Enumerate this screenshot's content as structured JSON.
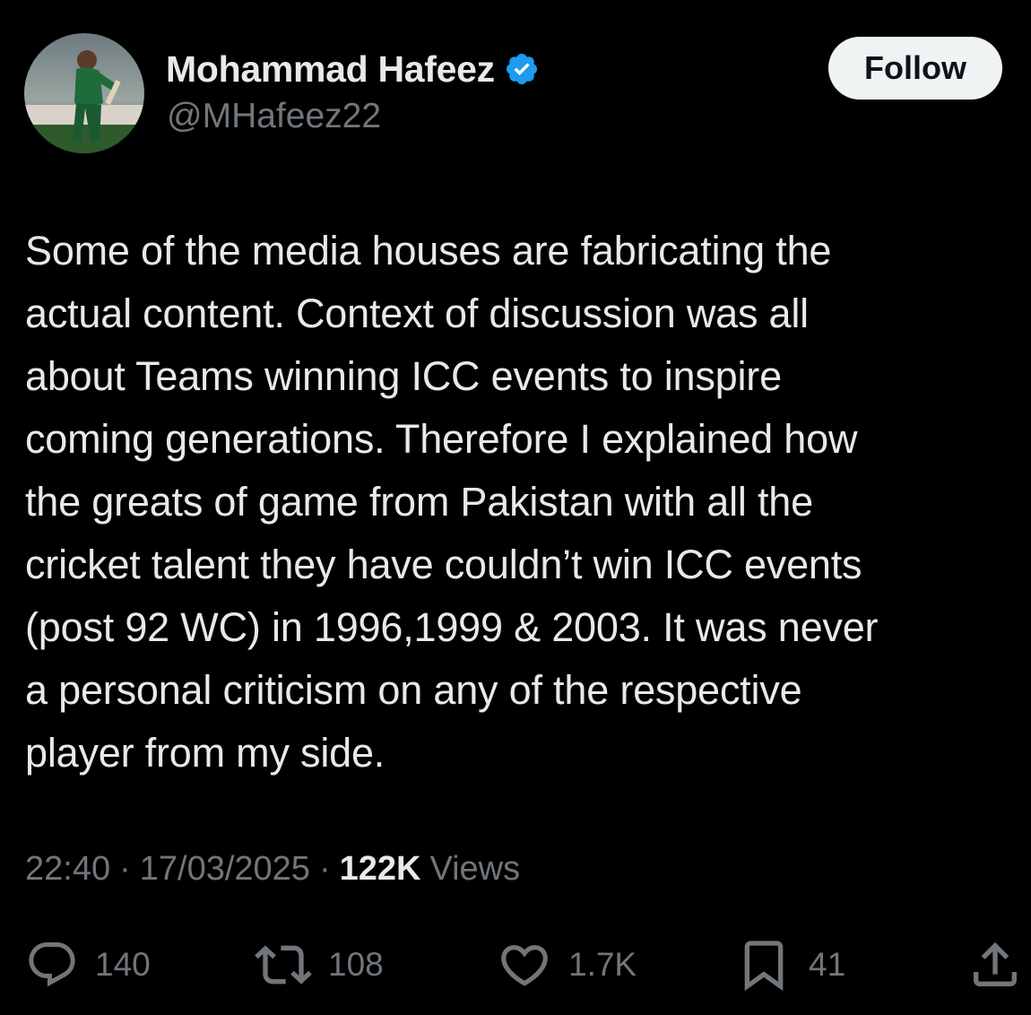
{
  "author": {
    "display_name": "Mohammad Hafeez",
    "handle": "@MHafeez22",
    "verified_color": "#1d9bf0"
  },
  "follow_button": {
    "label": "Follow"
  },
  "tweet": {
    "text": "Some of the media houses are fabricating the\nactual content. Context of discussion was all\nabout Teams winning ICC events to inspire\ncoming generations. Therefore I explained how\nthe greats of game from Pakistan with all the\ncricket talent they have couldn’t win ICC events\n(post 92 WC) in 1996,1999 & 2003. It was never\na personal criticism on any of the respective\nplayer from my side.",
    "time": "22:40",
    "date": "17/03/2025",
    "separator": "·",
    "views_count": "122K",
    "views_label": "Views"
  },
  "actions": {
    "replies": "140",
    "reposts": "108",
    "likes": "1.7K",
    "bookmarks": "41"
  },
  "icons": {
    "reply": "reply-icon",
    "repost": "repost-icon",
    "like": "heart-icon",
    "bookmark": "bookmark-icon",
    "share": "share-icon",
    "verified": "verified-badge-icon"
  }
}
